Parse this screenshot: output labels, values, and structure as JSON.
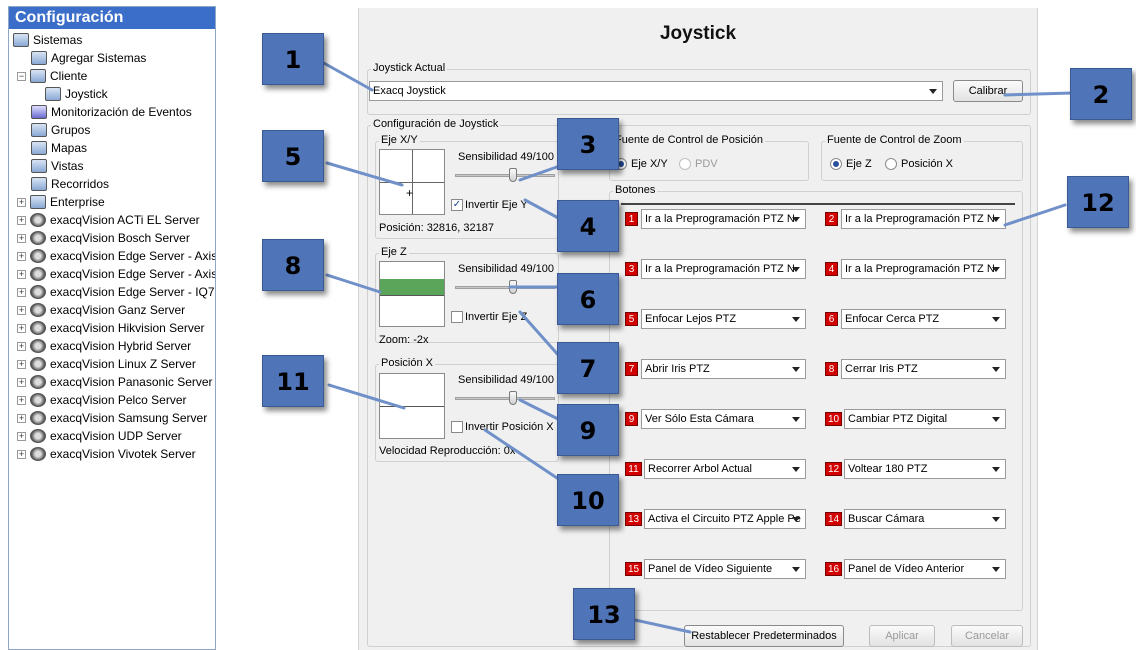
{
  "tree": {
    "title": "Configuración",
    "items": [
      {
        "label": "Sistemas",
        "icon": "systems-icon"
      },
      {
        "label": "Agregar Sistemas",
        "icon": "add-system-icon"
      },
      {
        "label": "Cliente",
        "icon": "client-gear-icon"
      },
      {
        "label": "Joystick",
        "icon": "joystick-icon"
      },
      {
        "label": "Monitorización de Eventos",
        "icon": "event-monitor-icon"
      },
      {
        "label": "Grupos",
        "icon": "groups-icon"
      },
      {
        "label": "Mapas",
        "icon": "maps-icon"
      },
      {
        "label": "Vistas",
        "icon": "views-icon"
      },
      {
        "label": "Recorridos",
        "icon": "tours-icon"
      },
      {
        "label": "Enterprise",
        "icon": "enterprise-icon"
      },
      {
        "label": "exacqVision ACTi EL Server",
        "icon": "server-icon"
      },
      {
        "label": "exacqVision Bosch Server",
        "icon": "server-icon"
      },
      {
        "label": "exacqVision Edge Server - Axis",
        "icon": "server-icon"
      },
      {
        "label": "exacqVision Edge Server - Axis",
        "icon": "server-icon"
      },
      {
        "label": "exacqVision Edge Server - IQ76",
        "icon": "server-icon"
      },
      {
        "label": "exacqVision Ganz Server",
        "icon": "server-icon"
      },
      {
        "label": "exacqVision Hikvision Server",
        "icon": "server-icon"
      },
      {
        "label": "exacqVision Hybrid Server",
        "icon": "server-icon"
      },
      {
        "label": "exacqVision Linux Z Server",
        "icon": "server-icon"
      },
      {
        "label": "exacqVision Panasonic Server",
        "icon": "server-icon"
      },
      {
        "label": "exacqVision Pelco Server",
        "icon": "server-icon"
      },
      {
        "label": "exacqVision Samsung Server",
        "icon": "server-icon"
      },
      {
        "label": "exacqVision UDP Server",
        "icon": "server-icon"
      },
      {
        "label": "exacqVision Vivotek Server",
        "icon": "server-icon"
      }
    ]
  },
  "main": {
    "title": "Joystick",
    "current": {
      "group_label": "Joystick Actual",
      "selected": "Exacq Joystick",
      "calibrate": "Calibrar"
    },
    "config_label": "Configuración de Joystick",
    "xy": {
      "label": "Eje X/Y",
      "sensitivity": "Sensibilidad 49/100",
      "sensitivity_value": 49,
      "invert": "Invertir Eje Y",
      "invert_checked": true,
      "position": "Posición:  32816, 32187"
    },
    "z": {
      "label": "Eje Z",
      "sensitivity": "Sensibilidad 49/100",
      "sensitivity_value": 49,
      "invert": "Invertir Eje Z",
      "invert_checked": false,
      "zoom": "Zoom:  -2x"
    },
    "px": {
      "label": "Posición X",
      "sensitivity": "Sensibilidad 49/100",
      "sensitivity_value": 49,
      "invert": "Invertir Posición X",
      "invert_checked": false,
      "speed": "Velocidad Reproducción:   0x"
    },
    "position_source": {
      "label": "Fuente de Control de Posición",
      "options": [
        "Eje X/Y",
        "PDV"
      ],
      "selected": "Eje X/Y"
    },
    "zoom_source": {
      "label": "Fuente de Control de Zoom",
      "options": [
        "Eje Z",
        "Posición X"
      ],
      "selected": "Eje Z"
    },
    "buttons_label": "Botones",
    "buttons": [
      {
        "num": "1",
        "action": "Ir a la Preprogramación PTZ N"
      },
      {
        "num": "2",
        "action": "Ir a la Preprogramación PTZ N"
      },
      {
        "num": "3",
        "action": "Ir a la Preprogramación PTZ N"
      },
      {
        "num": "4",
        "action": "Ir a la Preprogramación PTZ N"
      },
      {
        "num": "5",
        "action": "Enfocar Lejos PTZ"
      },
      {
        "num": "6",
        "action": "Enfocar Cerca PTZ"
      },
      {
        "num": "7",
        "action": "Abrir Iris PTZ"
      },
      {
        "num": "8",
        "action": "Cerrar Iris PTZ"
      },
      {
        "num": "9",
        "action": "Ver Sólo Esta Cámara"
      },
      {
        "num": "10",
        "action": "Cambiar PTZ Digital"
      },
      {
        "num": "11",
        "action": "Recorrer Arbol Actual"
      },
      {
        "num": "12",
        "action": "Voltear 180 PTZ"
      },
      {
        "num": "13",
        "action": "Activa el Circuito PTZ Apple Pe"
      },
      {
        "num": "14",
        "action": "Buscar Cámara"
      },
      {
        "num": "15",
        "action": "Panel de Vídeo Siguiente"
      },
      {
        "num": "16",
        "action": "Panel de Vídeo Anterior"
      }
    ],
    "footer": {
      "reset": "Restablecer Predeterminados",
      "apply": "Aplicar",
      "cancel": "Cancelar"
    }
  },
  "callouts": [
    "1",
    "2",
    "3",
    "4",
    "5",
    "6",
    "7",
    "8",
    "9",
    "10",
    "11",
    "12",
    "13"
  ],
  "colors": {
    "tree_header": "#3a6ec8",
    "callout": "#4f74b8",
    "badge": "#d20000",
    "z_bar": "#5aa55a"
  }
}
